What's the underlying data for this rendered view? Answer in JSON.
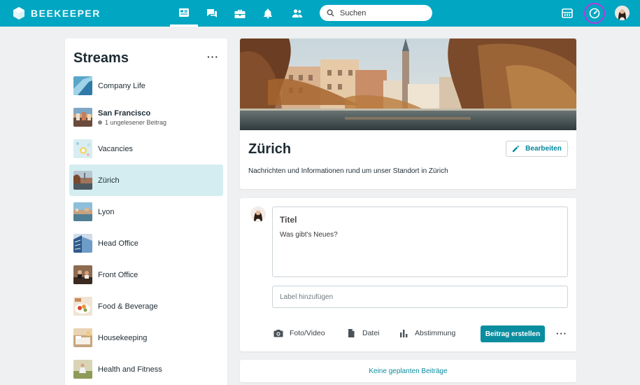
{
  "app": {
    "name": "BEEKEEPER"
  },
  "nav": {
    "items": [
      {
        "icon": "streams-icon",
        "active": true
      },
      {
        "icon": "chat-icon",
        "active": false
      },
      {
        "icon": "apps-icon",
        "active": false
      },
      {
        "icon": "bell-icon",
        "active": false
      },
      {
        "icon": "people-icon",
        "active": false
      }
    ]
  },
  "search": {
    "placeholder": "Suchen"
  },
  "colors": {
    "brand": "#00a6c2",
    "accent": "#0b8da0",
    "active_stream": "#d4edf0",
    "highlight_ring": "#b53ae0"
  },
  "sidebar": {
    "title": "Streams",
    "more": "···",
    "items": [
      {
        "label": "Company Life",
        "thumb": "company-life-thumbnail"
      },
      {
        "label": "San Francisco",
        "sub": "1 ungelesener Beitrag",
        "unread": true,
        "thumb": "san-francisco-thumbnail"
      },
      {
        "label": "Vacancies",
        "thumb": "vacancies-thumbnail"
      },
      {
        "label": "Zürich",
        "active": true,
        "thumb": "zurich-thumbnail"
      },
      {
        "label": "Lyon",
        "thumb": "lyon-thumbnail"
      },
      {
        "label": "Head Office",
        "thumb": "head-office-thumbnail"
      },
      {
        "label": "Front Office",
        "thumb": "front-office-thumbnail"
      },
      {
        "label": "Food & Beverage",
        "thumb": "food-beverage-thumbnail"
      },
      {
        "label": "Housekeeping",
        "thumb": "housekeeping-thumbnail"
      },
      {
        "label": "Health and Fitness",
        "thumb": "health-fitness-thumbnail"
      }
    ]
  },
  "stream": {
    "name": "Zürich",
    "edit_label": "Bearbeiten",
    "description": "Nachrichten und Informationen rund um unser Standort in Zürich"
  },
  "composer": {
    "title_placeholder": "Titel",
    "body_placeholder": "Was gibt's Neues?",
    "label_placeholder": "Label hinzufügen",
    "actions": {
      "photo": "Foto/Video",
      "file": "Datei",
      "poll": "Abstimmung"
    },
    "submit": "Beitrag erstellen",
    "more": "···"
  },
  "scheduled": {
    "label": "Keine geplanten Beiträge"
  }
}
